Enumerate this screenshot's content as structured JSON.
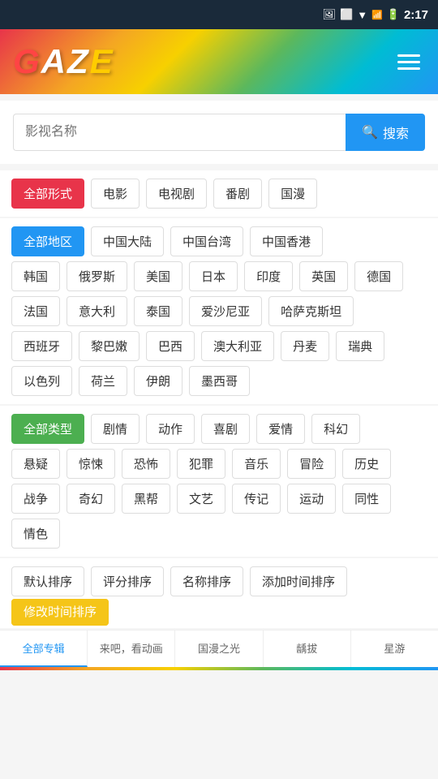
{
  "statusBar": {
    "time": "2:17"
  },
  "header": {
    "logo": "GAZE",
    "menu_label": "菜单"
  },
  "search": {
    "placeholder": "影视名称",
    "button_label": "搜索"
  },
  "filters": {
    "format": {
      "active": "全部形式",
      "items": [
        "电影",
        "电视剧",
        "番剧",
        "国漫"
      ]
    },
    "region1": {
      "active": "全部地区",
      "items": [
        "中国大陆",
        "中国台湾",
        "中国香港"
      ]
    },
    "region2": {
      "items": [
        "韩国",
        "俄罗斯",
        "美国",
        "日本",
        "印度",
        "英国",
        "德国"
      ]
    },
    "region3": {
      "items": [
        "法国",
        "意大利",
        "泰国",
        "爱沙尼亚",
        "哈萨克斯坦"
      ]
    },
    "region4": {
      "items": [
        "西班牙",
        "黎巴嫩",
        "巴西",
        "澳大利亚",
        "丹麦",
        "瑞典"
      ]
    },
    "region5": {
      "items": [
        "以色列",
        "荷兰",
        "伊朗",
        "墨西哥"
      ]
    },
    "genre1": {
      "active": "全部类型",
      "items": [
        "剧情",
        "动作",
        "喜剧",
        "爱情",
        "科幻"
      ]
    },
    "genre2": {
      "items": [
        "悬疑",
        "惊悚",
        "恐怖",
        "犯罪",
        "音乐",
        "冒险",
        "历史"
      ]
    },
    "genre3": {
      "items": [
        "战争",
        "奇幻",
        "黑帮",
        "文艺",
        "传记",
        "运动",
        "同性"
      ]
    },
    "genre4": {
      "items": [
        "情色"
      ]
    }
  },
  "sort": {
    "items": [
      "默认排序",
      "评分排序",
      "名称排序",
      "添加时间排序"
    ],
    "active": "修改时间排序"
  },
  "bottomTabs": {
    "items": [
      "全部专辑",
      "来吧，看动画",
      "国漫之光",
      "龋拔",
      "星游"
    ]
  },
  "icons": {
    "search": "🔍",
    "wifi": "▼",
    "battery": "🔋",
    "menu": "☰"
  }
}
